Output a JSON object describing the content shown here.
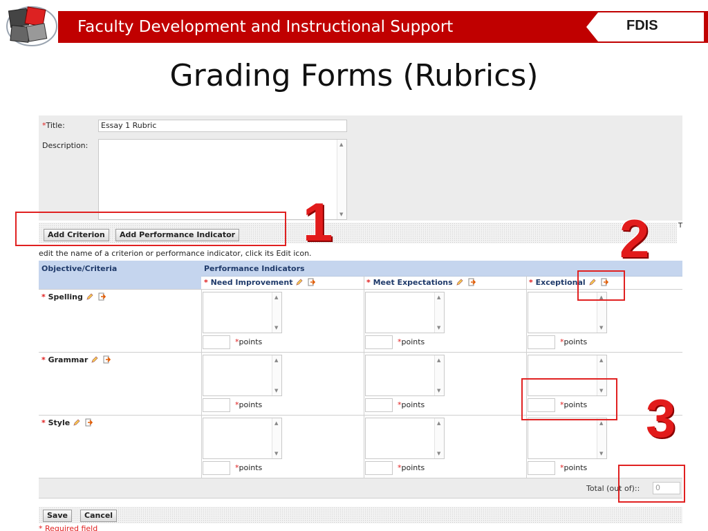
{
  "header": {
    "banner_title": "Faculty Development and Instructional Support",
    "brand": "FDIS",
    "slide_title": "Grading Forms (Rubrics)",
    "banner_color": "#c00000"
  },
  "form": {
    "title_label": "Title:",
    "title_value": "Essay 1 Rubric",
    "description_label": "Description:",
    "add_criterion_label": "Add Criterion",
    "add_performance_indicator_label": "Add Performance Indicator",
    "hint_text": "edit the name of a criterion or performance indicator, click its Edit icon.",
    "edge_text": "T"
  },
  "table": {
    "col_objective": "Objective/Criteria",
    "col_indicators": "Performance Indicators",
    "indicators": [
      "Need Improvement",
      "Meet Expectations",
      "Exceptional"
    ],
    "criteria": [
      "Spelling",
      "Grammar",
      "Style"
    ],
    "points_label": "points",
    "required_mark": "*",
    "header_color": "#c5d5ee"
  },
  "footer": {
    "total_label": "Total (out of)::",
    "total_value": "0",
    "save_label": "Save",
    "cancel_label": "Cancel",
    "required_note": "* Required field"
  },
  "annotations": [
    "1",
    "2",
    "3"
  ],
  "icons": [
    "logo-puzzle-icon",
    "pencil-icon",
    "edit-arrow-icon"
  ]
}
